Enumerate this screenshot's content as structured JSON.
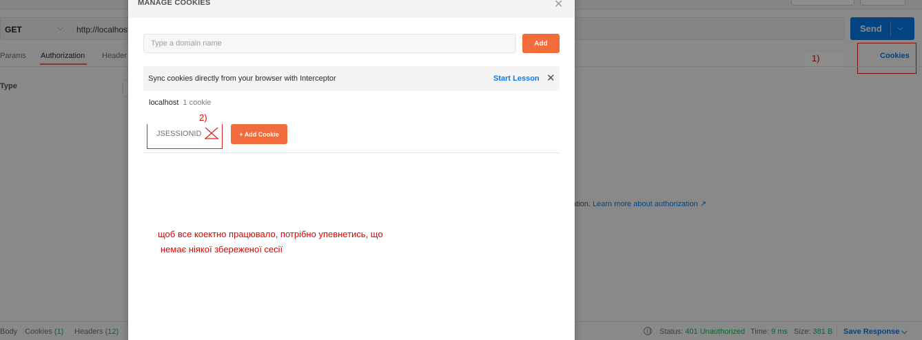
{
  "request": {
    "method": "GET",
    "url": "http://localhost",
    "send_label": "Send"
  },
  "tabs": [
    "Params",
    "Authorization",
    "Header"
  ],
  "cookies_link": "Cookies",
  "auth": {
    "type_label": "Type",
    "info_text": "ation.",
    "learn_more": "Learn more about authorization ↗"
  },
  "statusbar": {
    "body": "Body",
    "cookies": "Cookies",
    "cookies_count": "(1)",
    "headers": "Headers",
    "headers_count": "(12)",
    "status_label": "Status:",
    "status_value": "401 Unauthorized",
    "time_label": "Time:",
    "time_value": "9 ms",
    "size_label": "Size:",
    "size_value": "381 B",
    "save_response": "Save Response"
  },
  "modal": {
    "title": "MANAGE COOKIES",
    "domain_placeholder": "Type a domain name",
    "add_label": "Add",
    "sync_text": "Sync cookies directly from your browser with Interceptor",
    "start_lesson": "Start Lesson",
    "domain": "localhost",
    "domain_count": "1 cookie",
    "cookie_name": "JSESSIONID",
    "add_cookie_label": "+ Add Cookie"
  },
  "annotations": {
    "label1": "1)",
    "label2": "2)",
    "note_line1": "щоб все коектно працювало, потрібно упевнетись, що",
    "note_line2": "немає ніякої збереженої сесії"
  },
  "colors": {
    "accent_orange": "#f26b3a",
    "link_blue": "#097bed",
    "annotation_red": "#e00000",
    "status_green": "#0cbb52"
  },
  "icons": [
    "chevron-down-icon",
    "close-icon",
    "globe-icon",
    "delete-cross-icon"
  ]
}
